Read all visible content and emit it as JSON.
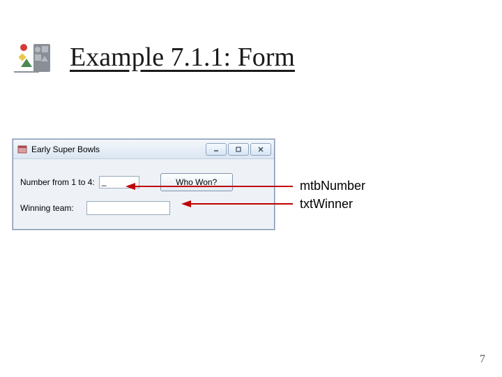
{
  "slide": {
    "title": "Example 7.1.1: Form",
    "page_number": "7"
  },
  "form_window": {
    "title": "Early Super Bowls",
    "label_number": "Number from 1 to 4:",
    "mtb_value": "_",
    "button_label": "Who Won?",
    "label_winner": "Winning team:",
    "txt_value": ""
  },
  "annotations": {
    "mtb_name": "mtbNumber",
    "txt_name": "txtWinner"
  }
}
